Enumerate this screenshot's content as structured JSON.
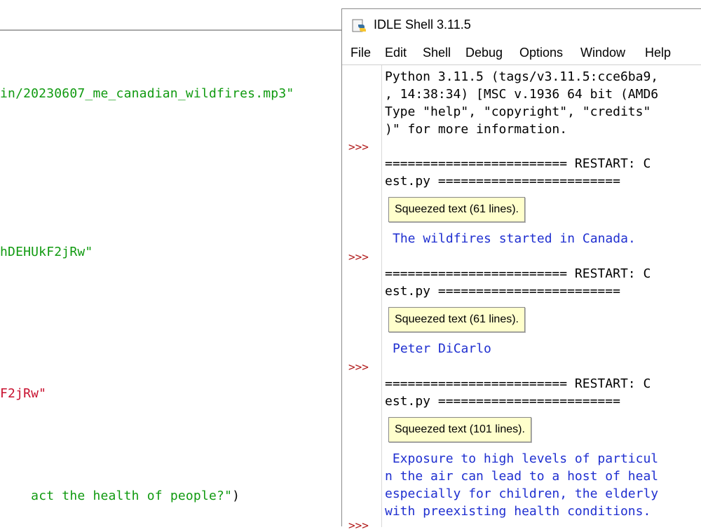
{
  "editor": {
    "lines": [
      {
        "text": "in/20230607_me_canadian_wildfires.mp3\""
      },
      {
        "text": "hDEHUkF2jRw\""
      },
      {
        "text": "F2jRw\""
      },
      {
        "text_green": "act the health of people?\"",
        "text_black": ")"
      }
    ]
  },
  "shell": {
    "title": "IDLE Shell 3.11.5",
    "menu": [
      "File",
      "Edit",
      "Shell",
      "Debug",
      "Options",
      "Window",
      "Help"
    ],
    "prompt": ">>>",
    "banner": [
      "Python 3.11.5 (tags/v3.11.5:cce6ba9,",
      ", 14:38:34) [MSC v.1936 64 bit (AMD6",
      "Type \"help\", \"copyright\", \"credits\" ",
      ")\" for more information."
    ],
    "restart_line1": "======================== RESTART: C",
    "restart_line2": "est.py ========================",
    "blocks": [
      {
        "squeezed": "Squeezed text (61 lines).",
        "output": "The wildfires started in Canada."
      },
      {
        "squeezed": "Squeezed text (61 lines).",
        "output": "Peter DiCarlo"
      },
      {
        "squeezed": "Squeezed text (101 lines).",
        "output_lines": [
          " Exposure to high levels of particul",
          "n the air can lead to a host of heal",
          "especially for children, the elderly",
          "with preexisting health conditions."
        ]
      }
    ]
  }
}
